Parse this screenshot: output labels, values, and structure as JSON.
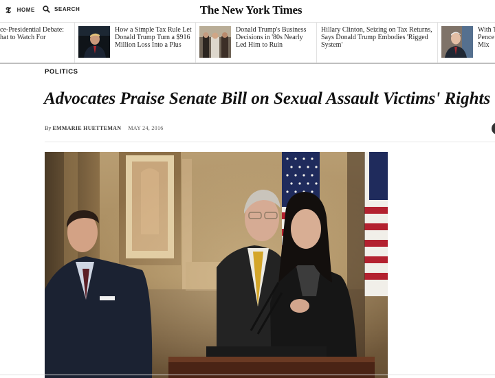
{
  "topbar": {
    "home_label": "HOME",
    "search_label": "SEARCH",
    "logo": "The New York Times"
  },
  "story_strip": [
    {
      "text": "ce-Presidential Debate: hat to Watch For",
      "thumb": null
    },
    {
      "text": "How a Simple Tax Rule Let Donald Trump Turn a $916 Million Loss Into a Plus",
      "thumb": "trump-portrait-dark"
    },
    {
      "text": "Donald Trump's Business Decisions in '80s Nearly Led Him to Ruin",
      "thumb": "trump-crowd-photo"
    },
    {
      "text": "Hillary Clinton, Seizing on Tax Returns, Says Donald Trump Embodies 'Rigged System'",
      "thumb": null
    },
    {
      "text": "With T Pence Mix",
      "thumb": "pence-portrait"
    }
  ],
  "article": {
    "section": "POLITICS",
    "headline": "Advocates Praise Senate Bill on Sexual Assault Victims' Rights",
    "byline_prefix": "By",
    "author": "EMMARIE HUETTEMAN",
    "date": "MAY 24, 2016",
    "photo": "press-conference-photo"
  },
  "colors": {
    "text": "#111111",
    "divider": "#e2e2e2",
    "photo_backdrop": "#8a6a3a"
  }
}
